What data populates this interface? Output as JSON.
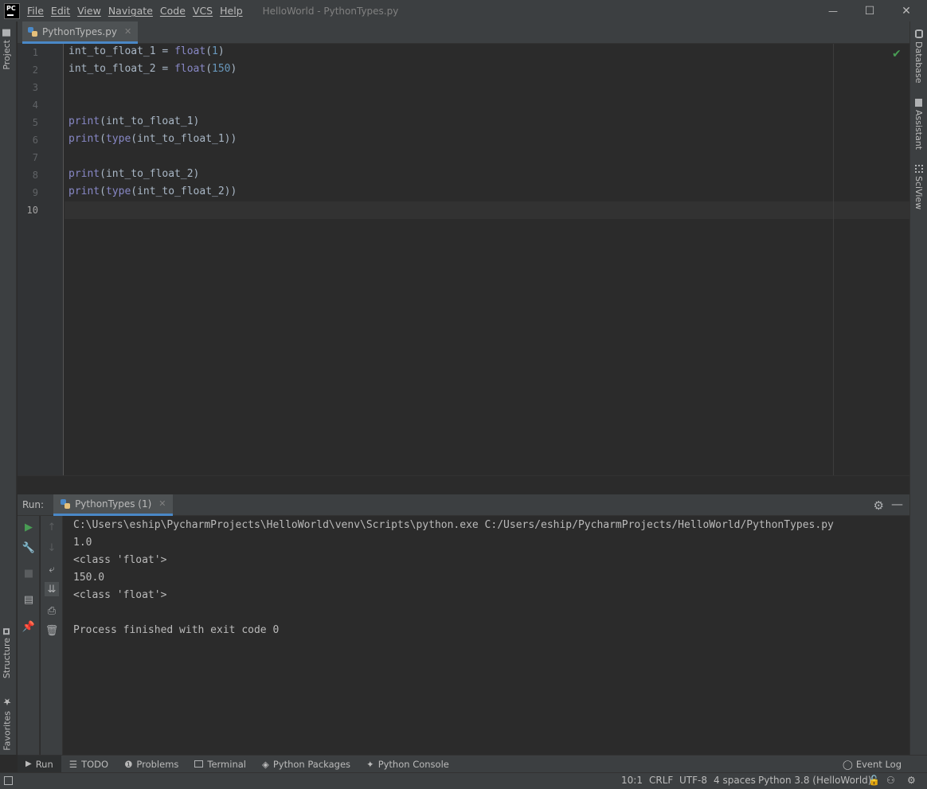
{
  "title_bar": {
    "logo": "PC",
    "menus": [
      "File",
      "Edit",
      "View",
      "Navigate",
      "Code",
      "VCS",
      "Help"
    ],
    "window_title": "HelloWorld - PythonTypes.py",
    "controls": {
      "minimize": "—",
      "maximize": "☐",
      "close": "✕"
    }
  },
  "left_strip": {
    "project": "Project",
    "structure": "Structure",
    "favorites": "Favorites"
  },
  "right_strip": {
    "database": "Database",
    "assistant": "Assistant",
    "sciview": "SciView"
  },
  "editor": {
    "tab_label": "PythonTypes.py",
    "line_numbers": [
      "1",
      "2",
      "3",
      "4",
      "5",
      "6",
      "7",
      "8",
      "9",
      "10"
    ],
    "lines": [
      "int_to_float_1 = float(1)",
      "int_to_float_2 = float(150)",
      "",
      "",
      "print(int_to_float_1)",
      "print(type(int_to_float_1))",
      "",
      "print(int_to_float_2)",
      "print(type(int_to_float_2))",
      ""
    ]
  },
  "run": {
    "label": "Run:",
    "tab_label": "PythonTypes (1)",
    "console": [
      "C:\\Users\\eship\\PycharmProjects\\HelloWorld\\venv\\Scripts\\python.exe C:/Users/eship/PycharmProjects/HelloWorld/PythonTypes.py",
      "1.0",
      "<class 'float'>",
      "150.0",
      "<class 'float'>",
      "",
      "Process finished with exit code 0"
    ]
  },
  "bottom_tabs": {
    "run": "Run",
    "todo": "TODO",
    "problems": "Problems",
    "terminal": "Terminal",
    "python_packages": "Python Packages",
    "python_console": "Python Console",
    "event_log": "Event Log"
  },
  "status_bar": {
    "caret": "10:1",
    "line_sep": "CRLF",
    "encoding": "UTF-8",
    "indent": "4 spaces",
    "interpreter": "Python 3.8 (HelloWorld)"
  },
  "colors": {
    "bg_editor": "#2b2b2b",
    "bg_panel": "#3c3f41",
    "text": "#a9b7c6",
    "builtin": "#8888c6",
    "number": "#6897bb",
    "accent_tab": "#4a88c7",
    "run_green": "#499c54"
  }
}
